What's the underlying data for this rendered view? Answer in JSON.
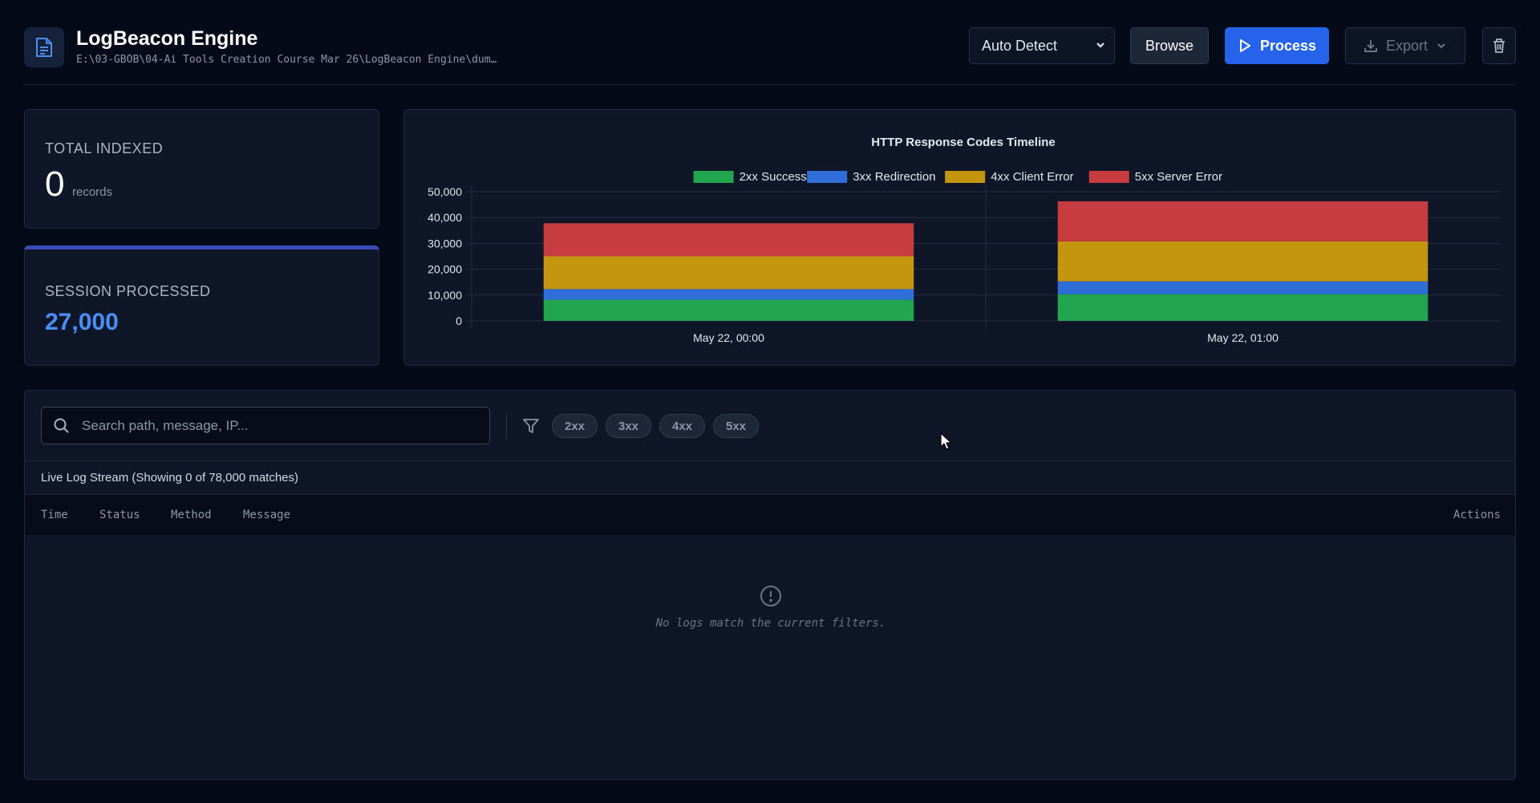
{
  "header": {
    "title": "LogBeacon Engine",
    "path": "E:\\03-GBOB\\04-Ai Tools Creation Course Mar 26\\LogBeacon Engine\\dum…",
    "format_select": "Auto Detect",
    "browse_label": "Browse",
    "process_label": "Process",
    "export_label": "Export"
  },
  "stats": {
    "total_label": "TOTAL INDEXED",
    "total_value": "0",
    "total_unit": "records",
    "session_label": "SESSION PROCESSED",
    "session_value": "27,000"
  },
  "chart_data": {
    "type": "bar",
    "stacked": true,
    "title": "HTTP Response Codes Timeline",
    "categories": [
      "May 22, 00:00",
      "May 22, 01:00"
    ],
    "series": [
      {
        "name": "2xx Success",
        "color": "#22a54f",
        "values": [
          8200,
          10300
        ]
      },
      {
        "name": "3xx Redirection",
        "color": "#2f6ed8",
        "values": [
          4100,
          5000
        ]
      },
      {
        "name": "4xx Client Error",
        "color": "#c4950e",
        "values": [
          12700,
          15500
        ]
      },
      {
        "name": "5xx Server Error",
        "color": "#c73c3e",
        "values": [
          12800,
          15500
        ]
      }
    ],
    "ylim": [
      0,
      50000
    ],
    "yticks": [
      "0",
      "10,000",
      "20,000",
      "30,000",
      "40,000",
      "50,000"
    ],
    "grid": true,
    "legend": "top-center"
  },
  "log": {
    "search_placeholder": "Search path, message, IP...",
    "filters": [
      "2xx",
      "3xx",
      "4xx",
      "5xx"
    ],
    "stream_title": "Live Log Stream (Showing 0 of 78,000 matches)",
    "columns": {
      "time": "Time",
      "status": "Status",
      "method": "Method",
      "message": "Message",
      "actions": "Actions"
    },
    "empty_message": "No logs match the current filters."
  }
}
